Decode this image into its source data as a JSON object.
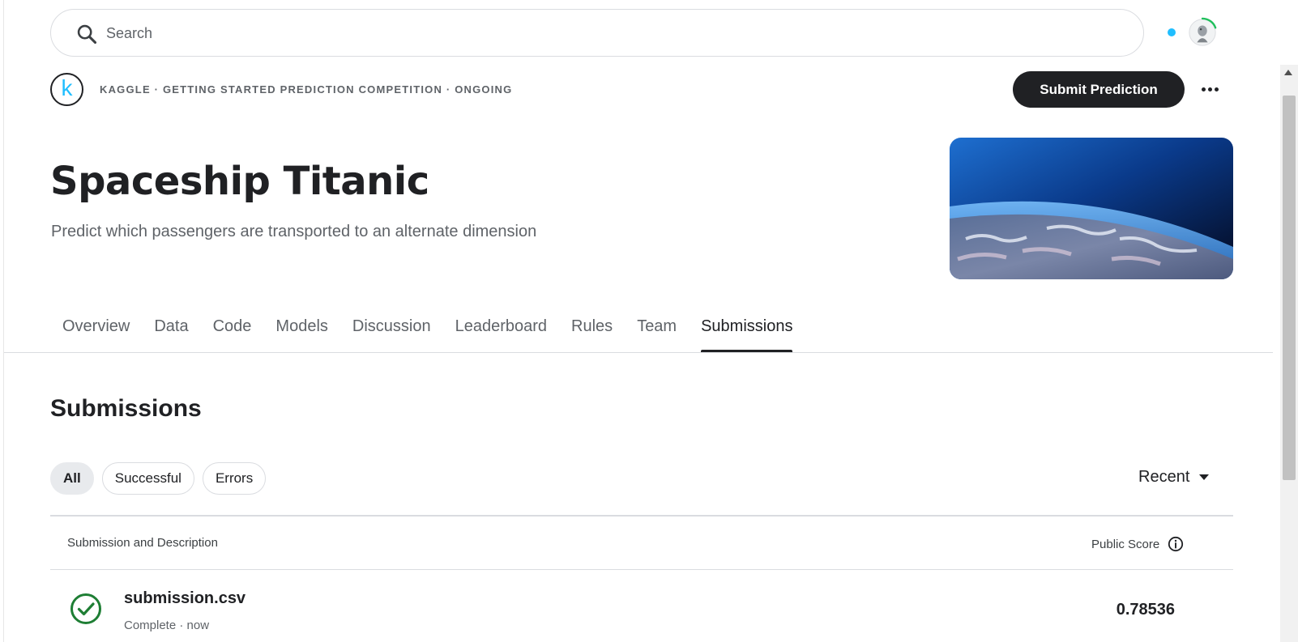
{
  "search": {
    "placeholder": "Search",
    "value": ""
  },
  "header": {
    "logo_letter": "k",
    "breadcrumb": "KAGGLE · GETTING STARTED PREDICTION COMPETITION · ONGOING",
    "submit_label": "Submit Prediction"
  },
  "competition": {
    "title": "Spaceship Titanic",
    "subtitle": "Predict which passengers are transported to an alternate dimension"
  },
  "tabs": [
    {
      "label": "Overview"
    },
    {
      "label": "Data"
    },
    {
      "label": "Code"
    },
    {
      "label": "Models"
    },
    {
      "label": "Discussion"
    },
    {
      "label": "Leaderboard"
    },
    {
      "label": "Rules"
    },
    {
      "label": "Team"
    },
    {
      "label": "Submissions",
      "active": true
    }
  ],
  "submissions": {
    "heading": "Submissions",
    "filters": [
      {
        "label": "All",
        "active": true
      },
      {
        "label": "Successful"
      },
      {
        "label": "Errors"
      }
    ],
    "sort_label": "Recent",
    "columns": {
      "left": "Submission and Description",
      "right": "Public Score"
    },
    "rows": [
      {
        "file": "submission.csv",
        "status": "Complete · now",
        "score": "0.78536"
      }
    ]
  },
  "colors": {
    "accent": "#20beff",
    "success": "#1e7e34",
    "dark": "#202124"
  }
}
